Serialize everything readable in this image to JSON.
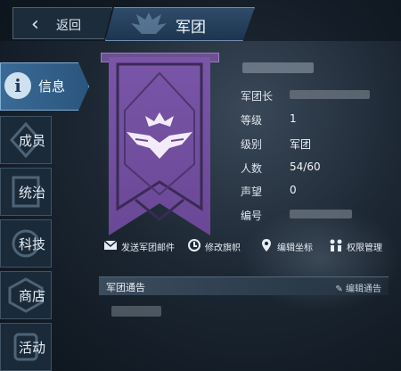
{
  "header": {
    "back_label": "返回",
    "title": "军团"
  },
  "nav": {
    "items": [
      {
        "label": "信息",
        "active": true
      },
      {
        "label": "成员"
      },
      {
        "label": "统治"
      },
      {
        "label": "科技"
      },
      {
        "label": "商店"
      },
      {
        "label": "活动"
      }
    ]
  },
  "banner": {
    "emblem_icon": "crown-wings-emblem",
    "color": "#7a55a8"
  },
  "info": {
    "rows": [
      {
        "label": "军团长",
        "value": ""
      },
      {
        "label": "等级",
        "value": "1"
      },
      {
        "label": "级别",
        "value": "军团"
      },
      {
        "label": "人数",
        "value": "54/60"
      },
      {
        "label": "声望",
        "value": "0"
      },
      {
        "label": "编号",
        "value": ""
      }
    ]
  },
  "actions": {
    "send_mail": "发送军团邮件",
    "edit_flag": "修改旗帜",
    "edit_coords": "编辑坐标",
    "permissions": "权限管理"
  },
  "notice": {
    "title": "军团通告",
    "edit_label": "编辑通告"
  }
}
